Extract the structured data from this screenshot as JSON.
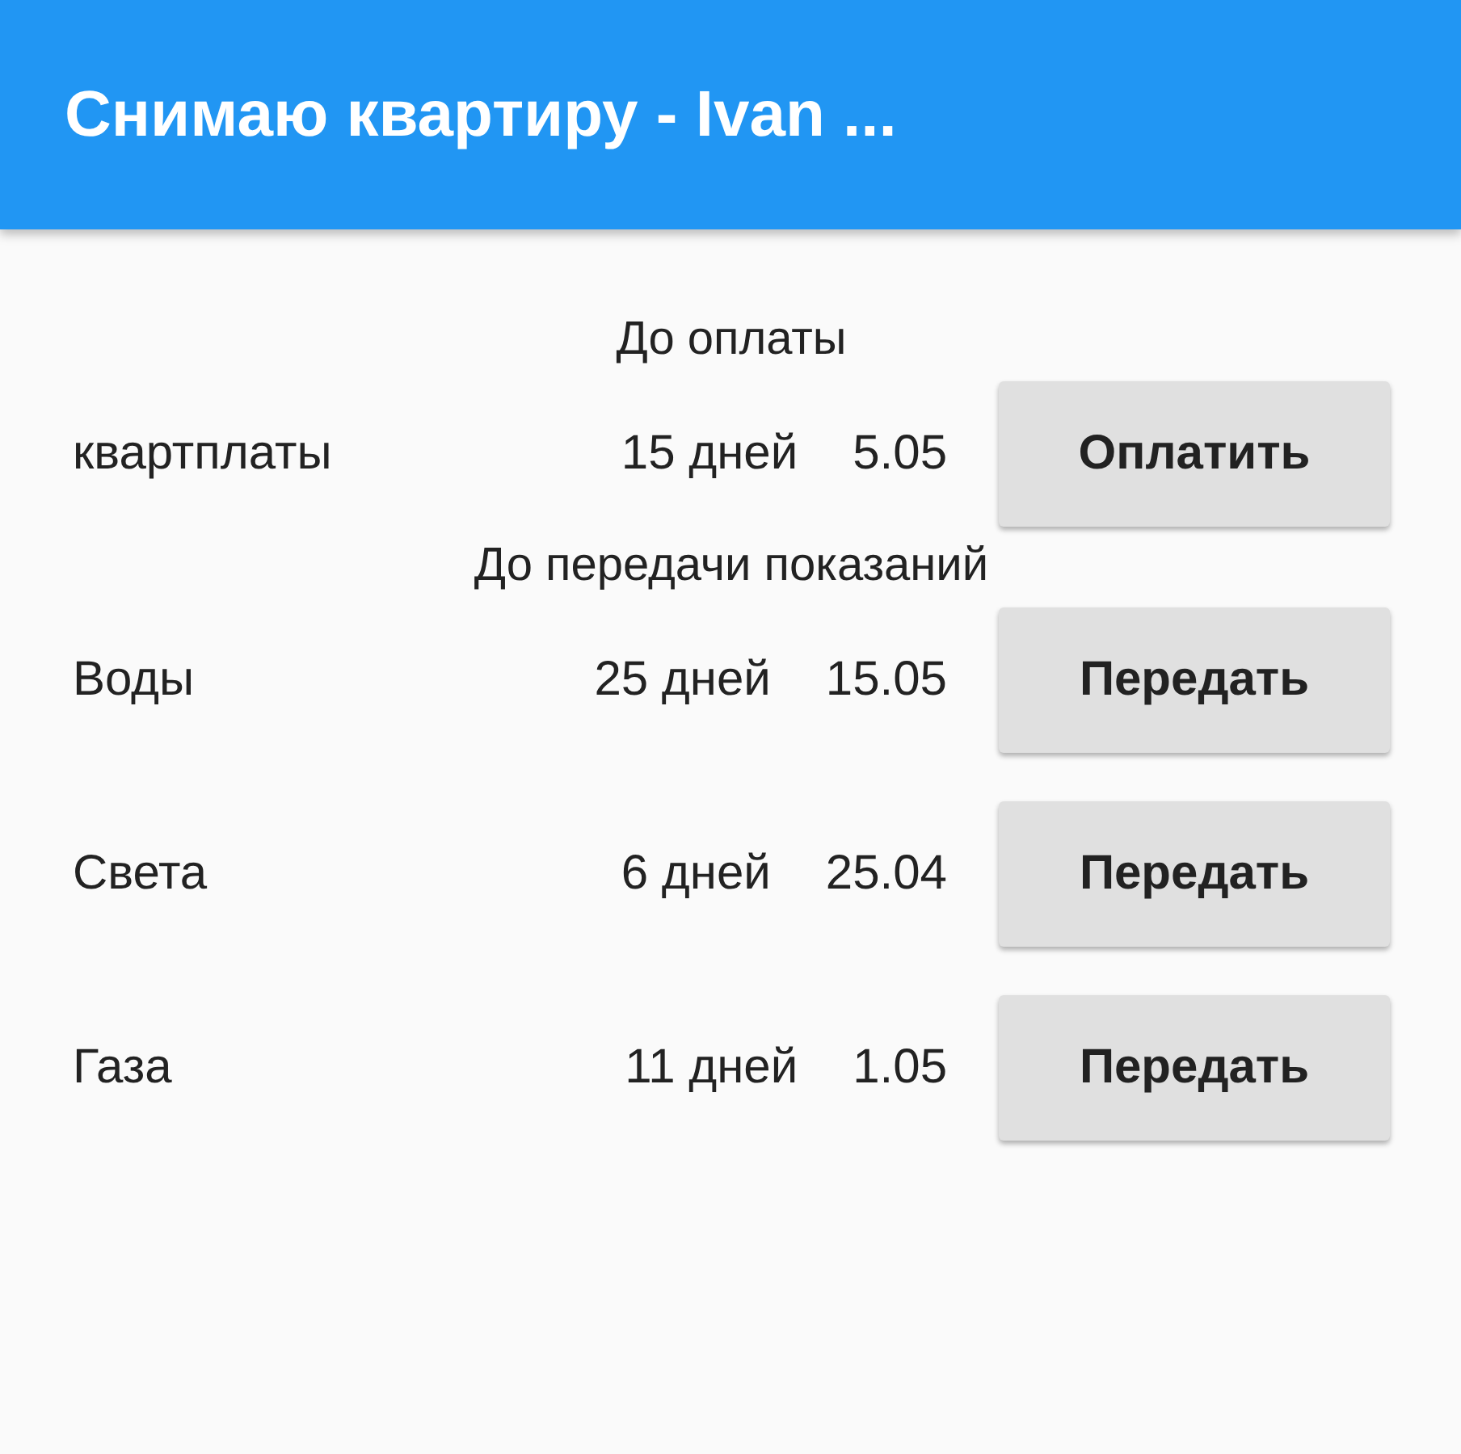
{
  "app_bar": {
    "title": "Снимаю квартиру - Ivan ..."
  },
  "sections": [
    {
      "heading": "До оплаты",
      "rows": [
        {
          "label": "квартплаты",
          "days": "15 дней",
          "date": "5.05",
          "button": "Оплатить"
        }
      ]
    },
    {
      "heading": "До передачи показаний",
      "rows": [
        {
          "label": "Воды",
          "days": "25 дней",
          "date": "15.05",
          "button": "Передать"
        },
        {
          "label": "Света",
          "days": "6 дней",
          "date": "25.04",
          "button": "Передать"
        },
        {
          "label": "Газа",
          "days": "11 дней",
          "date": "1.05",
          "button": "Передать"
        }
      ]
    }
  ]
}
